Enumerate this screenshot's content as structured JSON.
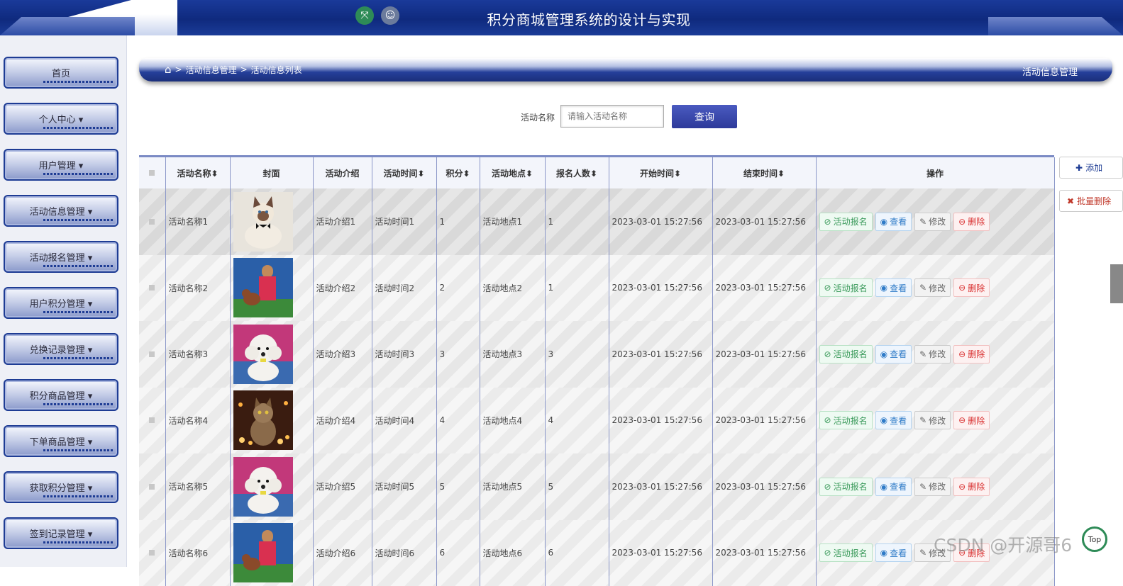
{
  "header": {
    "title": "积分商城管理系统的设计与实现",
    "fullscreen_icon": "fullscreen-icon",
    "user_icon": "user-icon"
  },
  "sidebar": {
    "items": [
      {
        "label": "首页"
      },
      {
        "label": "个人中心 ▾"
      },
      {
        "label": "用户管理 ▾"
      },
      {
        "label": "活动信息管理 ▾"
      },
      {
        "label": "活动报名管理 ▾"
      },
      {
        "label": "用户积分管理 ▾"
      },
      {
        "label": "兑换记录管理 ▾"
      },
      {
        "label": "积分商品管理 ▾"
      },
      {
        "label": "下单商品管理 ▾"
      },
      {
        "label": "获取积分管理 ▾"
      },
      {
        "label": "签到记录管理 ▾"
      }
    ]
  },
  "breadcrumb": {
    "sep": ">",
    "level1": "活动信息管理",
    "level2": "活动信息列表",
    "right": "活动信息管理"
  },
  "search": {
    "label": "活动名称",
    "placeholder": "请输入活动名称",
    "button": "查询"
  },
  "side_actions": {
    "add": "添加",
    "batch_delete": "批量删除"
  },
  "table": {
    "headers": [
      "活动名称⬍",
      "封面",
      "活动介绍",
      "活动时间⬍",
      "积分⬍",
      "活动地点⬍",
      "报名人数⬍",
      "开始时间⬍",
      "结束时间⬍",
      "操作"
    ],
    "rows": [
      {
        "name": "活动名称1",
        "cover": "cat-with-bowtie",
        "intro": "活动介绍1",
        "time": "活动时间1",
        "points": "1",
        "place": "活动地点1",
        "count": "1",
        "start": "2023-03-01 15:27:56",
        "end": "2023-03-01 15:27:56"
      },
      {
        "name": "活动名称2",
        "cover": "girl-with-dog",
        "intro": "活动介绍2",
        "time": "活动时间2",
        "points": "2",
        "place": "活动地点2",
        "count": "1",
        "start": "2023-03-01 15:27:56",
        "end": "2023-03-01 15:27:56"
      },
      {
        "name": "活动名称3",
        "cover": "white-poodle",
        "intro": "活动介绍3",
        "time": "活动时间3",
        "points": "3",
        "place": "活动地点3",
        "count": "3",
        "start": "2023-03-01 15:27:56",
        "end": "2023-03-01 15:27:56"
      },
      {
        "name": "活动名称4",
        "cover": "cat-with-candles",
        "intro": "活动介绍4",
        "time": "活动时间4",
        "points": "4",
        "place": "活动地点4",
        "count": "4",
        "start": "2023-03-01 15:27:56",
        "end": "2023-03-01 15:27:56"
      },
      {
        "name": "活动名称5",
        "cover": "white-poodle",
        "intro": "活动介绍5",
        "time": "活动时间5",
        "points": "5",
        "place": "活动地点5",
        "count": "5",
        "start": "2023-03-01 15:27:56",
        "end": "2023-03-01 15:27:56"
      },
      {
        "name": "活动名称6",
        "cover": "girl-with-dog",
        "intro": "活动介绍6",
        "time": "活动时间6",
        "points": "6",
        "place": "活动地点6",
        "count": "6",
        "start": "2023-03-01 15:27:56",
        "end": "2023-03-01 15:27:56"
      }
    ],
    "actions": {
      "enroll": "活动报名",
      "view": "查看",
      "edit": "修改",
      "delete": "删除"
    }
  },
  "watermark": "CSDN @开源哥6",
  "top_button": "Top",
  "colors": {
    "header_blue": "#0f2a7e",
    "button_blue": "#2d3a9a",
    "enroll_green": "#3a9a5a",
    "view_blue": "#2f7bc8",
    "delete_red": "#d93030"
  }
}
